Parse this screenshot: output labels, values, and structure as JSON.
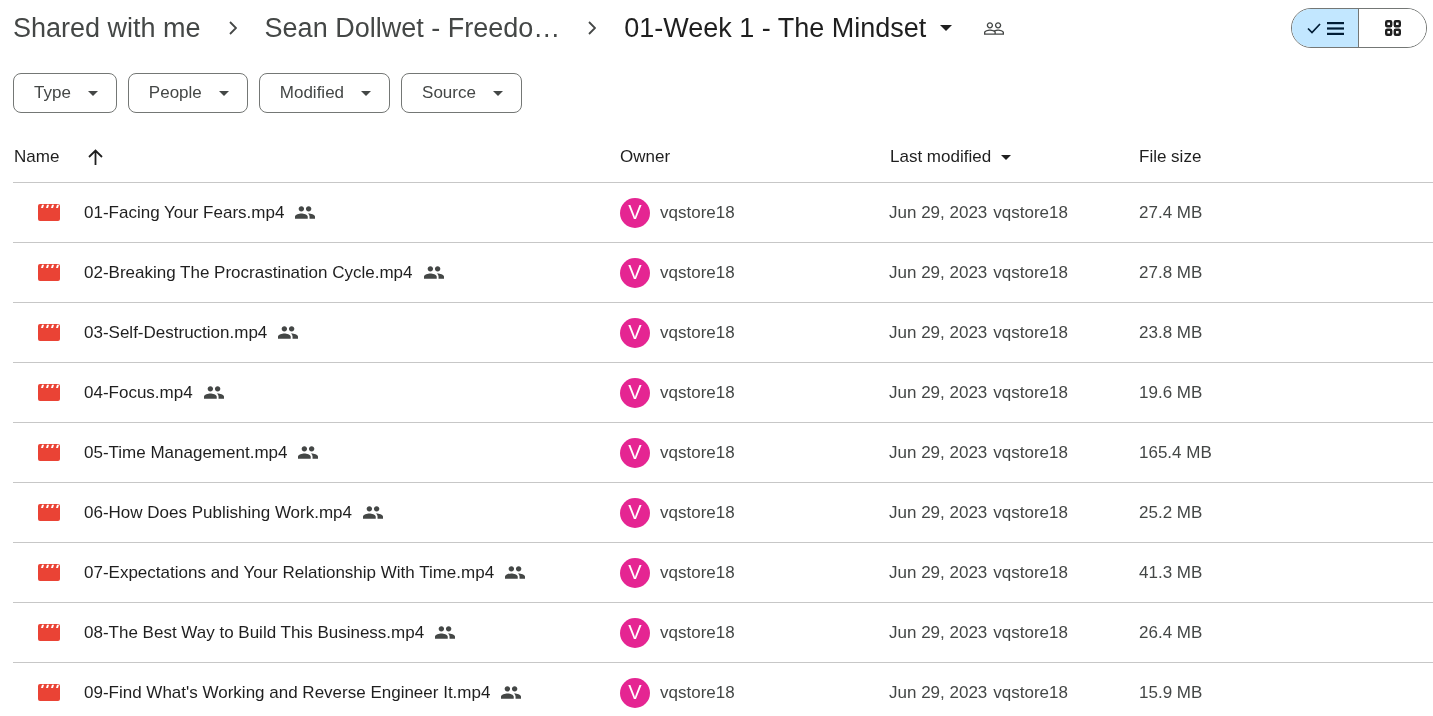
{
  "breadcrumbs": [
    {
      "label": "Shared with me",
      "current": false
    },
    {
      "label": "Sean Dollwet - Freedo…",
      "current": false
    },
    {
      "label": "01-Week 1 - The Mindset",
      "current": true
    }
  ],
  "view_toggle": [
    {
      "kind": "list",
      "selected": true
    },
    {
      "kind": "grid",
      "selected": false
    }
  ],
  "filters": [
    {
      "label": "Type"
    },
    {
      "label": "People"
    },
    {
      "label": "Modified"
    },
    {
      "label": "Source"
    }
  ],
  "table": {
    "columns": [
      {
        "label": "Name",
        "kind": "sortable"
      },
      {
        "label": "Owner",
        "kind": "plain"
      },
      {
        "label": "Last modified",
        "kind": "menu"
      },
      {
        "label": "File size",
        "kind": "plain"
      }
    ],
    "rows": [
      {
        "name": "01-Facing Your Fears.mp4",
        "shared": true,
        "owner_initial": "V",
        "owner": "vqstore18",
        "modified_date": "Jun 29, 2023",
        "modified_by": "vqstore18",
        "size": "27.4 MB"
      },
      {
        "name": "02-Breaking The Procrastination Cycle.mp4",
        "shared": true,
        "owner_initial": "V",
        "owner": "vqstore18",
        "modified_date": "Jun 29, 2023",
        "modified_by": "vqstore18",
        "size": "27.8 MB"
      },
      {
        "name": "03-Self-Destruction.mp4",
        "shared": true,
        "owner_initial": "V",
        "owner": "vqstore18",
        "modified_date": "Jun 29, 2023",
        "modified_by": "vqstore18",
        "size": "23.8 MB"
      },
      {
        "name": "04-Focus.mp4",
        "shared": true,
        "owner_initial": "V",
        "owner": "vqstore18",
        "modified_date": "Jun 29, 2023",
        "modified_by": "vqstore18",
        "size": "19.6 MB"
      },
      {
        "name": "05-Time Management.mp4",
        "shared": true,
        "owner_initial": "V",
        "owner": "vqstore18",
        "modified_date": "Jun 29, 2023",
        "modified_by": "vqstore18",
        "size": "165.4 MB"
      },
      {
        "name": "06-How Does Publishing Work.mp4",
        "shared": true,
        "owner_initial": "V",
        "owner": "vqstore18",
        "modified_date": "Jun 29, 2023",
        "modified_by": "vqstore18",
        "size": "25.2 MB"
      },
      {
        "name": "07-Expectations and Your Relationship With Time.mp4",
        "shared": true,
        "owner_initial": "V",
        "owner": "vqstore18",
        "modified_date": "Jun 29, 2023",
        "modified_by": "vqstore18",
        "size": "41.3 MB"
      },
      {
        "name": "08-The Best Way to Build This Business.mp4",
        "shared": true,
        "owner_initial": "V",
        "owner": "vqstore18",
        "modified_date": "Jun 29, 2023",
        "modified_by": "vqstore18",
        "size": "26.4 MB"
      },
      {
        "name": "09-Find What's Working and Reverse Engineer It.mp4",
        "shared": true,
        "owner_initial": "V",
        "owner": "vqstore18",
        "modified_date": "Jun 29, 2023",
        "modified_by": "vqstore18",
        "size": "15.9 MB"
      }
    ]
  }
}
